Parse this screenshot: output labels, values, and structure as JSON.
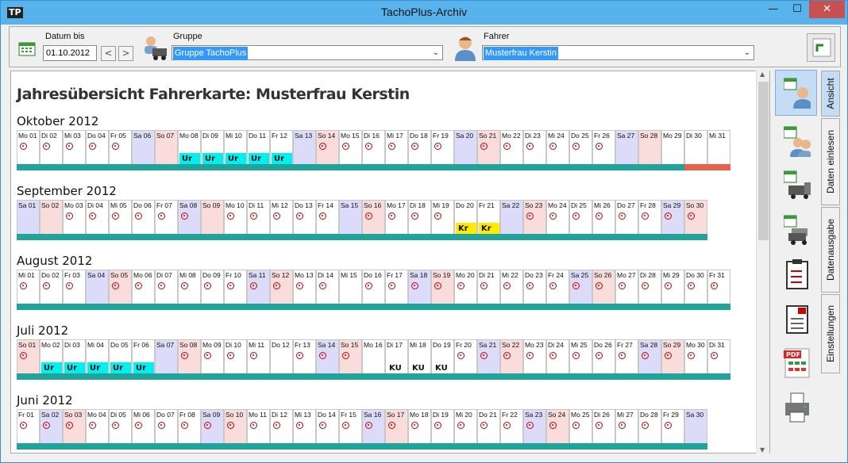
{
  "window": {
    "title": "TachoPlus-Archiv",
    "minimize": "—",
    "maximize": "☐",
    "close": "✕"
  },
  "toolbar": {
    "datum_label": "Datum bis",
    "datum_value": "01.10.2012",
    "prev": "<",
    "next": ">",
    "gruppe_label": "Gruppe",
    "gruppe_value": "Gruppe TachoPlus",
    "fahrer_label": "Fahrer",
    "fahrer_value": "Musterfrau Kerstin"
  },
  "main": {
    "heading": "Jahresübersicht Fahrerkarte: Musterfrau Kerstin"
  },
  "months": [
    {
      "title": "Oktober 2012",
      "days": [
        "Mo 01",
        "Di 02",
        "Mi 03",
        "Do 04",
        "Fr 05",
        "Sa 06",
        "So 07",
        "Mo 08",
        "Di 09",
        "Mi 10",
        "Do 11",
        "Fr 12",
        "Sa 13",
        "So 14",
        "Mo 15",
        "Di 16",
        "Mi 17",
        "Do 18",
        "Fr 19",
        "Sa 20",
        "So 21",
        "Mo 22",
        "Di 23",
        "Mi 24",
        "Do 25",
        "Fr 26",
        "Sa 27",
        "So 28",
        "Mo 29",
        "Di 30",
        "Mi 31"
      ],
      "badges": {
        "7": "Ur",
        "8": "Ur",
        "9": "Ur",
        "10": "Ur",
        "11": "Ur"
      },
      "wheels": [
        0,
        1,
        2,
        3,
        4,
        13,
        14,
        15,
        16,
        17,
        18,
        20,
        21,
        22,
        23,
        24,
        25
      ],
      "red": [
        29,
        30
      ]
    },
    {
      "title": "September 2012",
      "days": [
        "Sa 01",
        "So 02",
        "Mo 03",
        "Di 04",
        "Mi 05",
        "Do 06",
        "Fr 07",
        "Sa 08",
        "So 09",
        "Mo 10",
        "Di 11",
        "Mi 12",
        "Do 13",
        "Fr 14",
        "Sa 15",
        "So 16",
        "Mo 17",
        "Di 18",
        "Mi 19",
        "Do 20",
        "Fr 21",
        "Sa 22",
        "So 23",
        "Mo 24",
        "Di 25",
        "Mi 26",
        "Do 27",
        "Fr 28",
        "Sa 29",
        "So 30"
      ],
      "badges": {
        "19": "Kr",
        "20": "Kr"
      },
      "wheels": [
        2,
        3,
        4,
        5,
        6,
        7,
        9,
        10,
        11,
        12,
        13,
        15,
        16,
        17,
        18,
        22,
        23,
        24,
        25,
        26,
        27,
        28,
        29
      ],
      "red": []
    },
    {
      "title": "August 2012",
      "days": [
        "Mi 01",
        "Do 02",
        "Fr 03",
        "Sa 04",
        "So 05",
        "Mo 06",
        "Di 07",
        "Mi 08",
        "Do 09",
        "Fr 10",
        "Sa 11",
        "So 12",
        "Mo 13",
        "Di 14",
        "Mi 15",
        "Do 16",
        "Fr 17",
        "Sa 18",
        "So 19",
        "Mo 20",
        "Di 21",
        "Mi 22",
        "Do 23",
        "Fr 24",
        "Sa 25",
        "So 26",
        "Mo 27",
        "Di 28",
        "Mi 29",
        "Do 30",
        "Fr 31"
      ],
      "badges": {},
      "wheels": [
        0,
        1,
        2,
        4,
        5,
        6,
        7,
        8,
        9,
        10,
        11,
        12,
        13,
        15,
        16,
        17,
        18,
        19,
        20,
        21,
        22,
        23,
        24,
        25,
        26,
        27,
        28,
        29,
        30
      ],
      "red": []
    },
    {
      "title": "Juli 2012",
      "days": [
        "So 01",
        "Mo 02",
        "Di 03",
        "Mi 04",
        "Do 05",
        "Fr 06",
        "Sa 07",
        "So 08",
        "Mo 09",
        "Di 10",
        "Mi 11",
        "Do 12",
        "Fr 13",
        "Sa 14",
        "So 15",
        "Mo 16",
        "Di 17",
        "Mi 18",
        "Do 19",
        "Fr 20",
        "Sa 21",
        "So 22",
        "Mo 23",
        "Di 24",
        "Mi 25",
        "Do 26",
        "Fr 27",
        "Sa 28",
        "So 29",
        "Mo 30",
        "Di 31"
      ],
      "badges": {
        "1": "Ur",
        "2": "Ur",
        "3": "Ur",
        "4": "Ur",
        "5": "Ur",
        "16": "KU",
        "17": "KU",
        "18": "KU"
      },
      "wheels": [
        0,
        7,
        8,
        9,
        10,
        12,
        13,
        14,
        19,
        20,
        21,
        22,
        23,
        24,
        25,
        26,
        27,
        28,
        29,
        30
      ],
      "red": []
    },
    {
      "title": "Juni 2012",
      "days": [
        "Fr 01",
        "Sa 02",
        "So 03",
        "Mo 04",
        "Di 05",
        "Mi 06",
        "Do 07",
        "Fr 08",
        "Sa 09",
        "So 10",
        "Mo 11",
        "Di 12",
        "Mi 13",
        "Do 14",
        "Fr 15",
        "Sa 16",
        "So 17",
        "Mo 18",
        "Di 19",
        "Mi 20",
        "Do 21",
        "Fr 22",
        "Sa 23",
        "So 24",
        "Mo 25",
        "Di 26",
        "Mi 27",
        "Do 28",
        "Fr 29",
        "Sa 30"
      ],
      "badges": {},
      "wheels": [
        0,
        1,
        2,
        3,
        4,
        5,
        6,
        7,
        8,
        9,
        10,
        11,
        12,
        13,
        14,
        15,
        16,
        17,
        18,
        19,
        20,
        21,
        22,
        23,
        24,
        25,
        26,
        27,
        28
      ],
      "red": []
    }
  ],
  "tabs": [
    "Ansicht",
    "Daten einlesen",
    "Datenausgabe",
    "Einstellungen"
  ],
  "sidebar_icons": [
    "calendar-driver-icon",
    "calendar-group-icon",
    "calendar-truck-icon",
    "calendar-trucks-icon",
    "clipboard-icon",
    "report-icon",
    "pdf-icon",
    "printer-icon"
  ]
}
